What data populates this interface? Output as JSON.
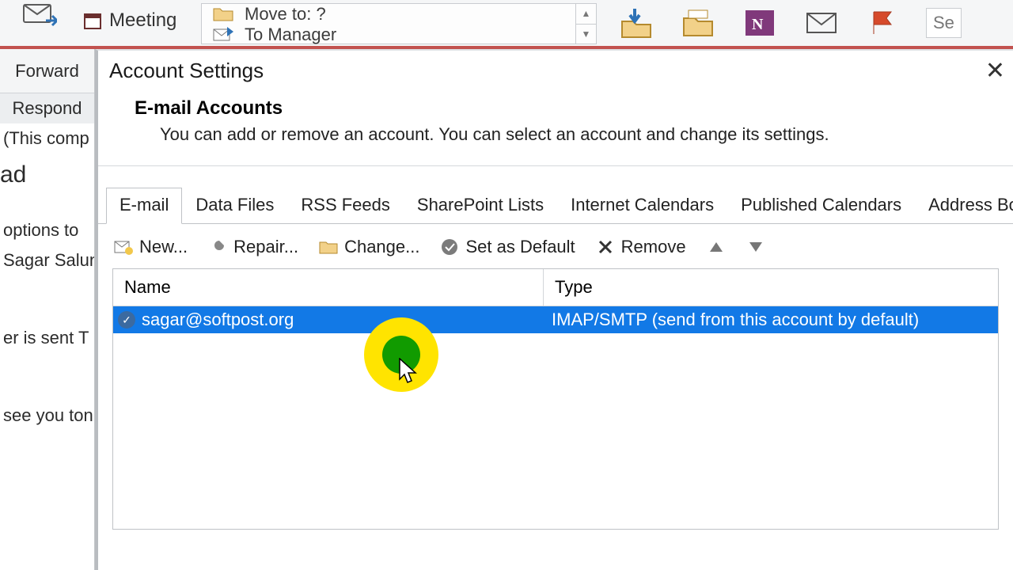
{
  "ribbon": {
    "forward": "Forward",
    "meeting": "Meeting",
    "quicksteps": {
      "move_to": "Move to: ?",
      "to_manager": "To Manager"
    },
    "search_fragment": "Se"
  },
  "left_pane": {
    "respond_group": "Respond",
    "lines": [
      "(This comp",
      "ad",
      "options to",
      "Sagar Salunl",
      "er is sent   T",
      "see you ton"
    ]
  },
  "dialog": {
    "title": "Account Settings",
    "heading": "E-mail Accounts",
    "subheading": "You can add or remove an account. You can select an account and change its settings.",
    "tabs": [
      "E-mail",
      "Data Files",
      "RSS Feeds",
      "SharePoint Lists",
      "Internet Calendars",
      "Published Calendars",
      "Address Books"
    ],
    "toolbar": {
      "new": "New...",
      "repair": "Repair...",
      "change": "Change...",
      "set_default": "Set as Default",
      "remove": "Remove"
    },
    "table": {
      "columns": {
        "name": "Name",
        "type": "Type"
      },
      "rows": [
        {
          "name": "sagar@softpost.org",
          "type": "IMAP/SMTP (send from this account by default)",
          "default": true,
          "selected": true
        }
      ]
    }
  }
}
